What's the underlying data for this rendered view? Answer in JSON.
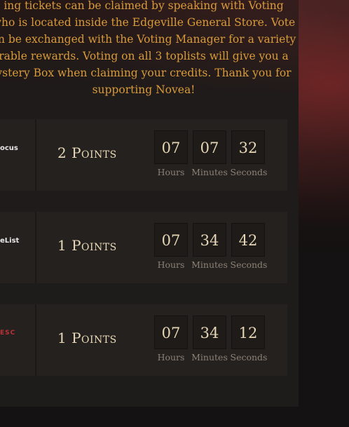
{
  "intro": {
    "lines": [
      "ing tickets can be claimed by speaking with Voting",
      "who is located inside the Edgeville General Store. Vote",
      "an be exchanged with the Voting Manager for a variety",
      "rable rewards. Voting on all 3 toplists will give you a",
      "ystery Box when claiming your credits. Thank you for",
      "supporting Novea!"
    ]
  },
  "labels": {
    "hours": "Hours",
    "minutes": "Minutes",
    "seconds": "Seconds"
  },
  "toplists": [
    {
      "site_fragment": "ocus",
      "points": "2 Points",
      "hours": "07",
      "minutes": "07",
      "seconds": "32"
    },
    {
      "site_fragment": "eList",
      "points": "1 Points",
      "hours": "07",
      "minutes": "34",
      "seconds": "42"
    },
    {
      "site_fragment": "ESC",
      "points": "1 Points",
      "hours": "07",
      "minutes": "34",
      "seconds": "12"
    }
  ],
  "colors": {
    "intro_text": "#d99a3a",
    "points_text": "#e8d9b8",
    "timer_text": "#e5d6b6",
    "label_text": "#8c8276",
    "row_bg": "#25211f",
    "logo_red": "#c0303a"
  }
}
